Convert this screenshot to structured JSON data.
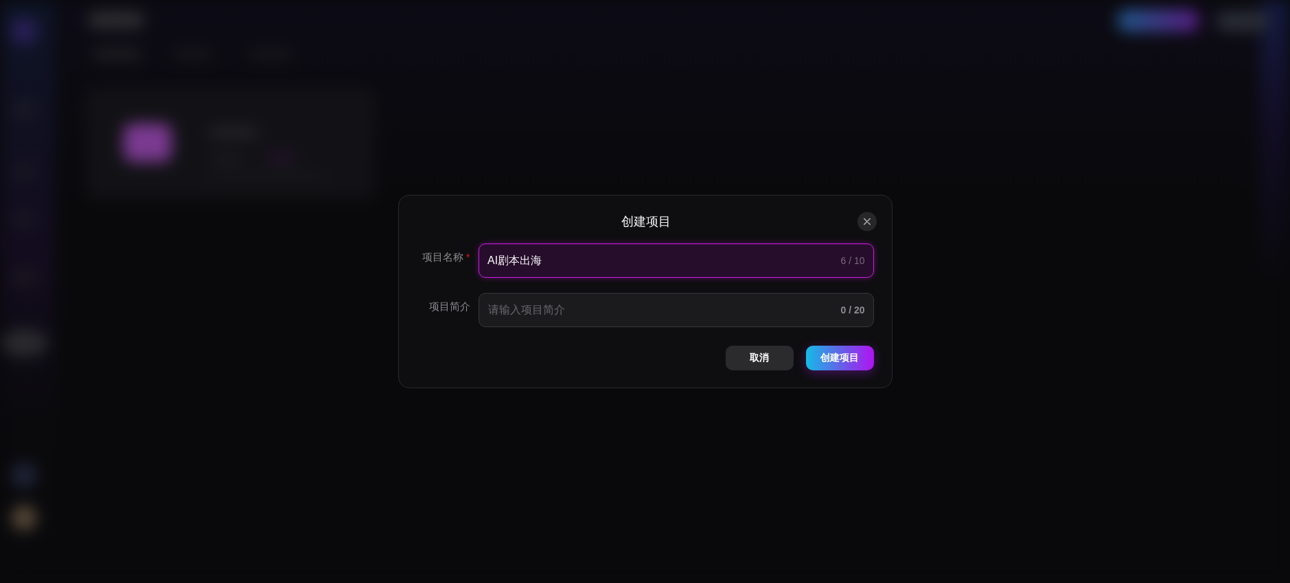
{
  "dialog": {
    "title": "创建项目",
    "fields": [
      {
        "label": "项目名称",
        "required_mark": "*",
        "value": "AI剧本出海",
        "counter": "6 / 10",
        "focused": true
      },
      {
        "label": "项目简介",
        "placeholder": "请输入项目简介",
        "counter": "0 / 20",
        "focused": false
      }
    ],
    "buttons": [
      {
        "label": "取消",
        "kind": "secondary"
      },
      {
        "label": "创建项目",
        "kind": "primary"
      }
    ]
  }
}
